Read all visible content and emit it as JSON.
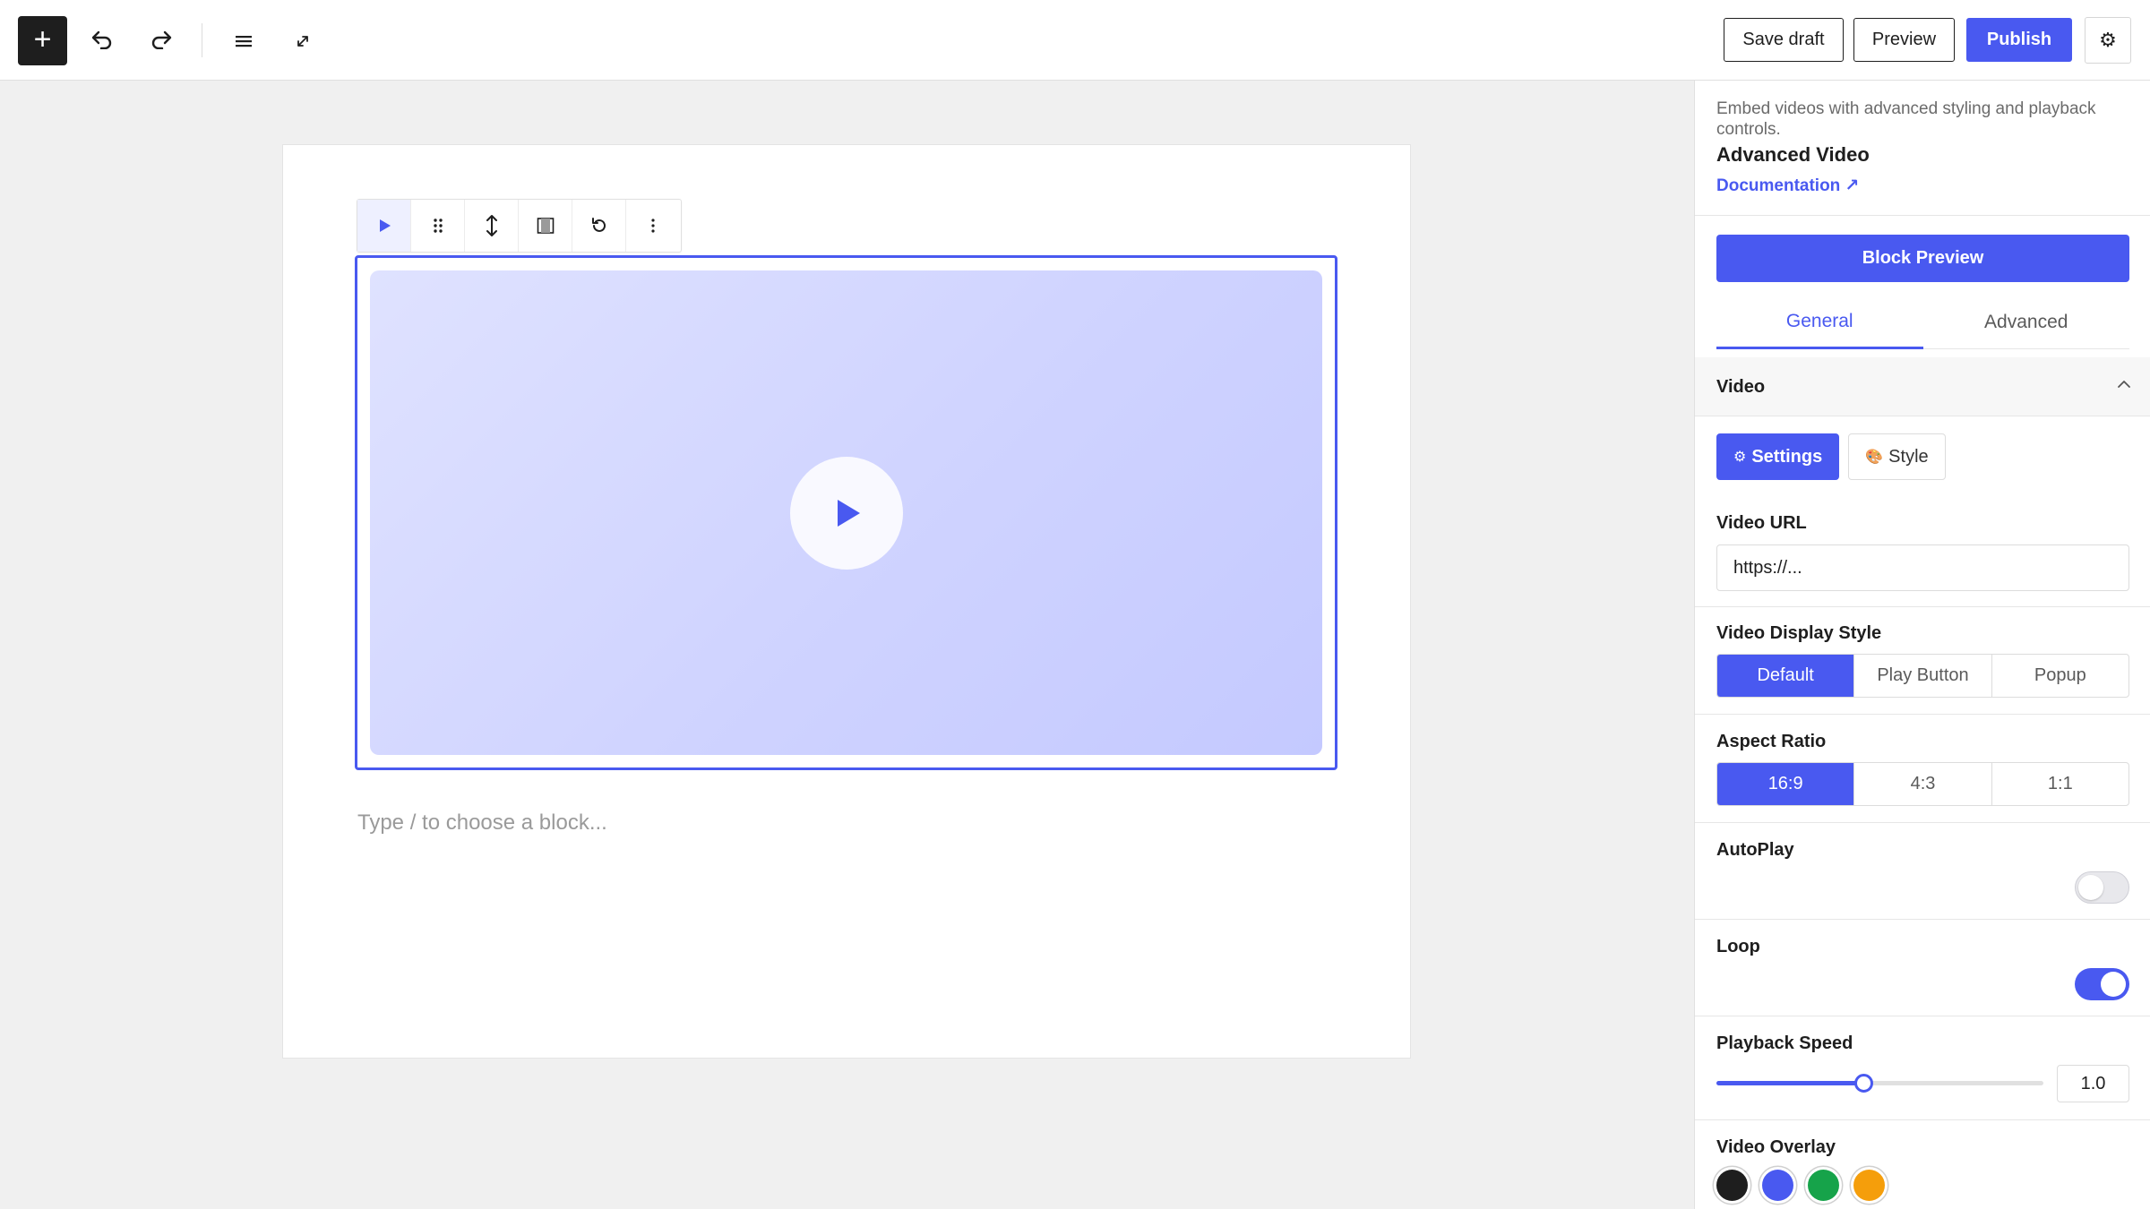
{
  "topbar": {
    "add_icon": "plus-icon",
    "undo_icon": "undo-icon",
    "redo_icon": "redo-icon",
    "list_icon": "list-view-icon",
    "expand_icon": "fullscreen-icon",
    "save_draft": "Save draft",
    "preview": "Preview",
    "publish": "Publish",
    "settings_icon": "gear-icon"
  },
  "block_toolbar": {
    "items": [
      "video-block-icon",
      "drag-handle-icon",
      "move-up-down-icon",
      "align-icon",
      "replace-icon",
      "more-options-icon"
    ]
  },
  "editor": {
    "placeholder": "Type / to choose a block..."
  },
  "sidebar": {
    "description": "Embed videos with advanced styling and playback controls.",
    "title": "Advanced Video",
    "documentation": "Documentation ↗",
    "block_preview": "Block Preview",
    "tabs": [
      "General",
      "Advanced"
    ],
    "active_tab": "General",
    "section": {
      "title": "Video",
      "expanded": true
    },
    "subtabs": {
      "settings": "Settings",
      "style": "Style",
      "settings_icon": "⚙",
      "style_icon": "🎨"
    },
    "video_url": {
      "label": "Video URL",
      "placeholder": "https://..."
    },
    "display_style": {
      "label": "Video Display Style",
      "options": [
        "Default",
        "Play Button",
        "Popup"
      ],
      "selected": "Default"
    },
    "aspect_ratio": {
      "label": "Aspect Ratio",
      "options": [
        "16:9",
        "4:3",
        "1:1"
      ],
      "selected": "16:9"
    },
    "autoplay": {
      "label": "AutoPlay",
      "enabled": false
    },
    "loop": {
      "label": "Loop",
      "enabled": true
    },
    "playback_speed": {
      "label": "Playback Speed",
      "value": "1.0",
      "slider_fraction": 0.45
    },
    "overlay": {
      "label": "Video Overlay",
      "colors": [
        "#1e1e1e",
        "#4959f0",
        "#16a34a",
        "#f59e0b"
      ]
    }
  },
  "colors": {
    "accent": "#4959f0"
  }
}
